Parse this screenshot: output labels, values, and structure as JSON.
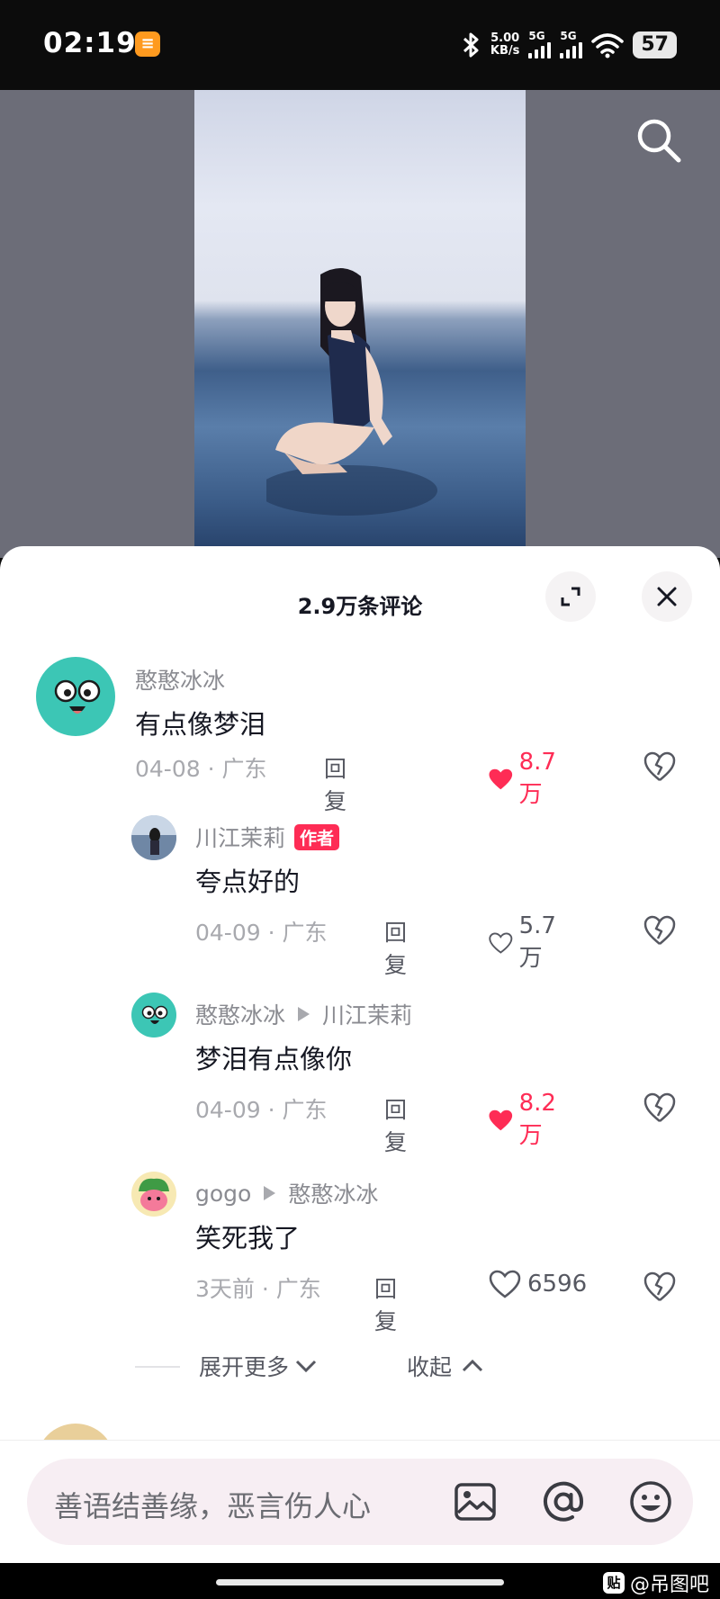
{
  "status_bar": {
    "time": "02:19",
    "net_speed_value": "5.00",
    "net_speed_unit": "KB/s",
    "signal1_label": "5G",
    "signal2_label": "5G",
    "battery": "57"
  },
  "sheet": {
    "title": "2.9万条评论"
  },
  "comments": [
    {
      "username": "憨憨冰冰",
      "text": "有点像梦泪",
      "date_location": "04-08 · 广东",
      "reply": "回复",
      "likes": "8.7万",
      "liked": true
    },
    {
      "username": "川江茉莉",
      "badge": "作者",
      "text": "夸点好的",
      "date_location": "04-09 · 广东",
      "reply": "回复",
      "likes": "5.7万",
      "liked": false
    },
    {
      "username": "憨憨冰冰",
      "reply_to": "川江茉莉",
      "text": "梦泪有点像你",
      "date_location": "04-09 · 广东",
      "reply": "回复",
      "likes": "8.2万",
      "liked": true
    },
    {
      "username": "gogo",
      "reply_to": "憨憨冰冰",
      "text": "笑死我了",
      "date_location": "3天前 · 广东",
      "reply": "回复",
      "likes": "6596",
      "liked": false
    }
  ],
  "thread_controls": {
    "expand_more": "展开更多",
    "collapse": "收起"
  },
  "input": {
    "placeholder": "善语结善缘，恶言伤人心"
  },
  "watermark": {
    "icon_text": "贴",
    "text": "@吊图吧"
  },
  "colors": {
    "accent_red": "#fe2c55",
    "teal_avatar": "#3cc6b5"
  }
}
